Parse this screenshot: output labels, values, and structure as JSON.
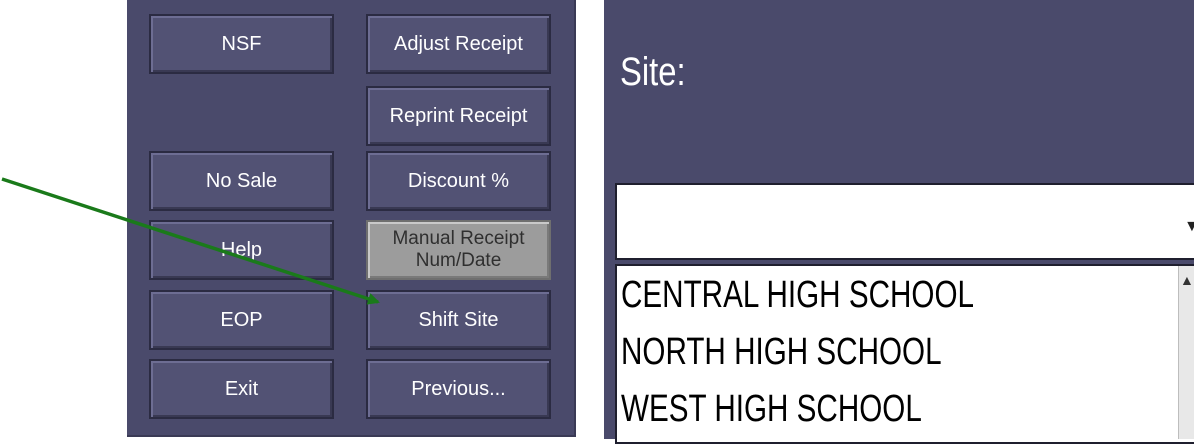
{
  "left_panel": {
    "buttons": {
      "nsf": "NSF",
      "adjust_receipt": "Adjust Receipt",
      "reprint_receipt": "Reprint Receipt",
      "no_sale": "No Sale",
      "discount": "Discount %",
      "help": "Help",
      "manual_receipt_line1": "Manual Receipt",
      "manual_receipt_line2": "Num/Date",
      "eop": "EOP",
      "shift_site": "Shift Site",
      "exit": "Exit",
      "previous": "Previous..."
    }
  },
  "site_panel": {
    "label": "Site:",
    "combo_value": "",
    "list_items": [
      "CENTRAL HIGH SCHOOL",
      "NORTH HIGH SCHOOL",
      "WEST HIGH SCHOOL"
    ]
  },
  "colors": {
    "panel_bg": "#4a4a6b",
    "button_bg": "#525274",
    "disabled_button_bg": "#9c9c9c",
    "annotation_arrow": "#1a7a1a"
  },
  "icons": {
    "combo_arrow": "chevron-down-icon",
    "scroll_up": "scroll-up-arrow-icon"
  }
}
